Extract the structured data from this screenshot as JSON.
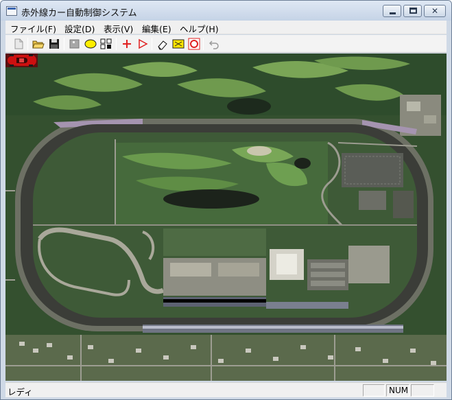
{
  "window": {
    "title": "赤外線カー自動制御システム"
  },
  "menu": [
    {
      "label": "ファイル(F)"
    },
    {
      "label": "設定(D)"
    },
    {
      "label": "表示(V)"
    },
    {
      "label": "編集(E)"
    },
    {
      "label": "ヘルプ(H)"
    }
  ],
  "toolbar": {
    "icons": [
      "new-file-icon",
      "open-folder-icon",
      "save-disk-icon",
      "square-tool-icon",
      "ellipse-tool-icon",
      "grid-tool-icon",
      "add-point-icon",
      "play-icon",
      "eraser-icon",
      "screenshot-icon",
      "target-icon",
      "undo-icon"
    ]
  },
  "map": {
    "car_icon": "red-car-icon"
  },
  "statusbar": {
    "text": "レディ",
    "panes": [
      "",
      "NUM",
      ""
    ]
  },
  "colors": {
    "toolbar_red": "#e02020",
    "toolbar_yellow": "#ffee00",
    "car_red": "#cc1010"
  }
}
